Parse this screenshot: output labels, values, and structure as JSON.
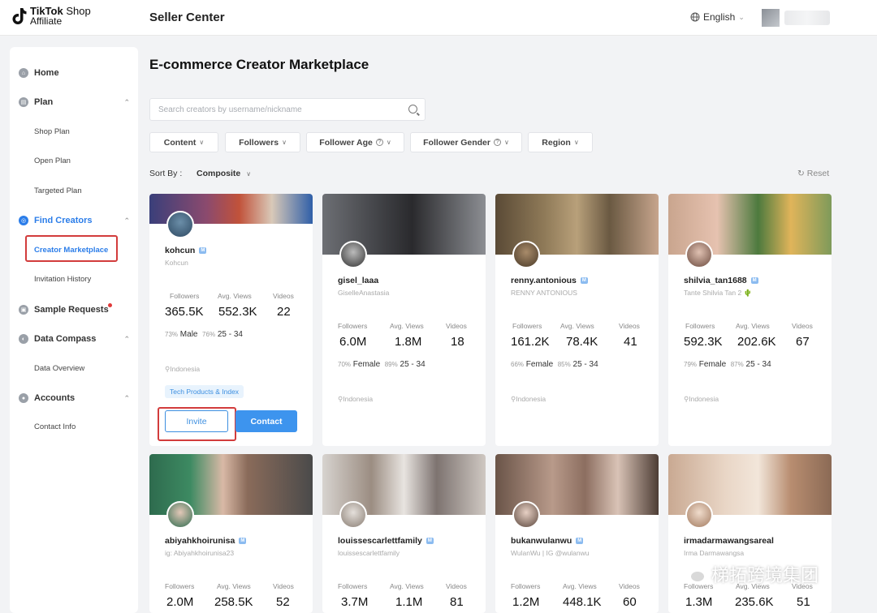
{
  "brand": {
    "line1_bold": "TikTok",
    "line1_light": " Shop",
    "line2": "Affiliate"
  },
  "header": {
    "title": "Seller Center",
    "language": "English"
  },
  "sidebar": {
    "home": "Home",
    "plan": "Plan",
    "shop_plan": "Shop Plan",
    "open_plan": "Open Plan",
    "targeted_plan": "Targeted Plan",
    "find_creators": "Find Creators",
    "creator_marketplace": "Creator Marketplace",
    "invitation_history": "Invitation History",
    "sample_requests": "Sample Requests",
    "data_compass": "Data Compass",
    "data_overview": "Data Overview",
    "accounts": "Accounts",
    "contact_info": "Contact Info"
  },
  "main": {
    "title": "E-commerce Creator Marketplace",
    "search_placeholder": "Search creators by username/nickname",
    "filters": {
      "content": "Content",
      "followers": "Followers",
      "follower_age": "Follower Age",
      "follower_gender": "Follower Gender",
      "region": "Region"
    },
    "sort_label": "Sort By :",
    "sort_value": "Composite",
    "reset": "Reset",
    "stat_labels": {
      "followers": "Followers",
      "avg_views": "Avg. Views",
      "videos": "Videos"
    }
  },
  "creators": [
    {
      "username": "kohcun",
      "nickname": "Kohcun",
      "followers": "365.5K",
      "avg_views": "552.3K",
      "videos": "22",
      "gender_pct": "73%",
      "gender": "Male",
      "age_pct": "76%",
      "age": "25 - 34",
      "location": "Indonesia",
      "tag": "Tech Products & Index",
      "invite": "Invite",
      "contact": "Contact"
    },
    {
      "username": "gisel_laaa",
      "nickname": "GiselleAnastasia",
      "followers": "6.0M",
      "avg_views": "1.8M",
      "videos": "18",
      "gender_pct": "70%",
      "gender": "Female",
      "age_pct": "89%",
      "age": "25 - 34",
      "location": "Indonesia"
    },
    {
      "username": "renny.antonious",
      "nickname": "RENNY ANTONIOUS",
      "followers": "161.2K",
      "avg_views": "78.4K",
      "videos": "41",
      "gender_pct": "66%",
      "gender": "Female",
      "age_pct": "85%",
      "age": "25 - 34",
      "location": "Indonesia"
    },
    {
      "username": "shilvia_tan1688",
      "nickname": "Tante Shilvia Tan 2 🌵",
      "followers": "592.3K",
      "avg_views": "202.6K",
      "videos": "67",
      "gender_pct": "79%",
      "gender": "Female",
      "age_pct": "87%",
      "age": "25 - 34",
      "location": "Indonesia"
    },
    {
      "username": "abiyahkhoirunisa",
      "nickname": "ig: Abiyahkhoirunisa23",
      "followers": "2.0M",
      "avg_views": "258.5K",
      "videos": "52"
    },
    {
      "username": "louissescarlettfamily",
      "nickname": "louissescarlettfamily",
      "followers": "3.7M",
      "avg_views": "1.1M",
      "videos": "81"
    },
    {
      "username": "bukanwulanwu",
      "nickname": "WulanWu | IG @wulanwu",
      "followers": "1.2M",
      "avg_views": "448.1K",
      "videos": "60"
    },
    {
      "username": "irmadarmawangsareal",
      "nickname": "Irma Darmawangsa",
      "followers": "1.3M",
      "avg_views": "235.6K",
      "videos": "51"
    }
  ],
  "watermark": "梯拓跨境集团"
}
